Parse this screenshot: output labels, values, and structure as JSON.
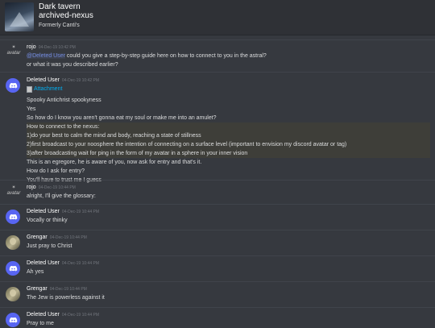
{
  "header": {
    "guild_name": "Dark tavern",
    "channel_name": "archived-nexus",
    "topic": "Formerly Canti's"
  },
  "messages": [
    {
      "author": "rojo",
      "timestamp": "04-Dec-19 10:42 PM",
      "avatar_text": "avatar",
      "mention": "@Deleted User",
      "lines": [
        "could you give a step-by-step guide here on how to connect to you in the astral?",
        "or what it was you described earlier?"
      ]
    },
    {
      "author": "Deleted User",
      "timestamp": "04-Dec-19 10:42 PM",
      "attachment": "Attachment",
      "lines": [
        "Spooky Antichrist spookyness",
        "Yes",
        "So how do I know you aren't gonna eat my soul or make me into an amulet?"
      ],
      "highlight_lines": [
        "How to connect to the nexus:",
        "1)do your best to calm the mind and body, reaching a state of stillness",
        "2)first broadcast to your noosphere the intention of connecting on a surface level (important to envision my discord avatar or tag)",
        "3)after broadcasting wait for ping in the form of my avatar in a sphere in your inner vision"
      ],
      "lines_after": [
        "This is an egregore, he is aware of you, now ask for entry and that's it.",
        "How do I ask for entry?",
        "You'll have to trust me I guess"
      ]
    },
    {
      "author": "rojo",
      "timestamp": "04-Dec-19 10:44 PM",
      "avatar_text": "avatar",
      "lines": [
        "alright, I'll give the glossary:"
      ]
    },
    {
      "author": "Deleted User",
      "timestamp": "04-Dec-19 10:44 PM",
      "lines": [
        "Vocally or thinky"
      ]
    },
    {
      "author": "Grengar",
      "timestamp": "04-Dec-19 10:44 PM",
      "lines": [
        "Just pray to Christ"
      ]
    },
    {
      "author": "Deleted User",
      "timestamp": "04-Dec-19 10:44 PM",
      "lines": [
        "Ah yes"
      ]
    },
    {
      "author": "Grengar",
      "timestamp": "04-Dec-19 10:44 PM",
      "lines": [
        "The Jew is powerless against it"
      ]
    },
    {
      "author": "Deleted User",
      "timestamp": "04-Dec-19 10:44 PM",
      "lines": [
        "Pray to me"
      ]
    }
  ]
}
